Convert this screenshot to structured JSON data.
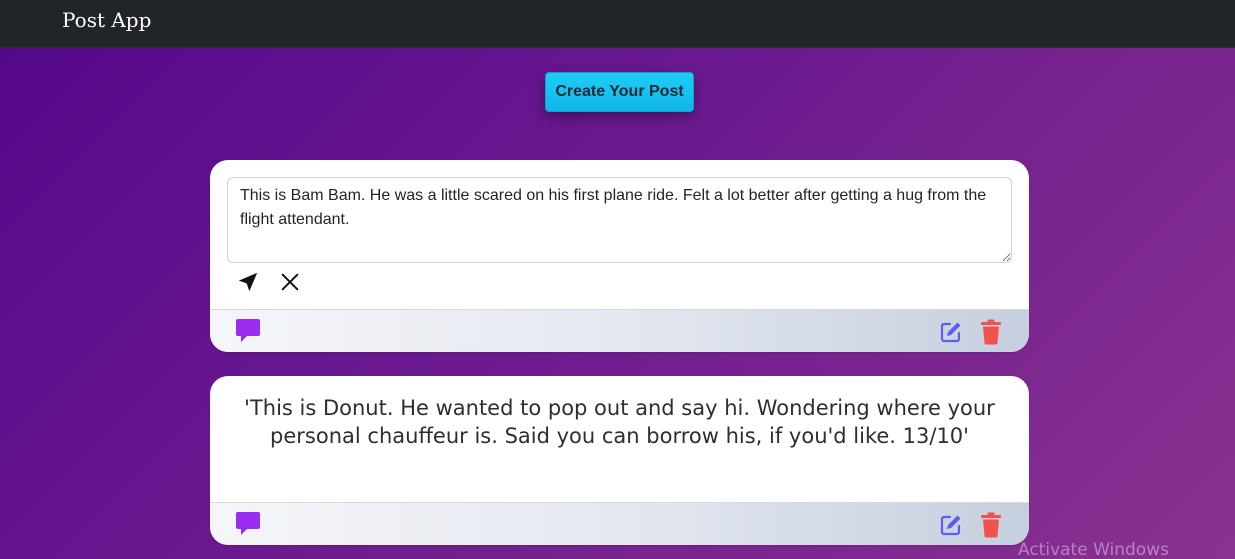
{
  "navbar": {
    "brand": "Post App"
  },
  "create_button": {
    "label": "Create Your Post"
  },
  "posts": [
    {
      "mode": "editing",
      "text": "This is Bam Bam. He was a little scared on his first plane ride. Felt a lot better after getting a hug from the flight attendant.",
      "actions": [
        "send-icon",
        "close-icon"
      ],
      "footer_icons": [
        "comment-icon",
        "edit-icon",
        "trash-icon"
      ]
    },
    {
      "mode": "view",
      "text": "'This is Donut. He wanted to pop out and say hi. Wondering where your personal chauffeur is. Said you can borrow his, if you'd like. 13/10'",
      "footer_icons": [
        "comment-icon",
        "edit-icon",
        "trash-icon"
      ]
    }
  ],
  "colors": {
    "comment": "#9b2bf0",
    "edit": "#5b5ff0",
    "delete": "#f0524c",
    "create_button": "#1fcdf6",
    "navbar": "#212529"
  },
  "watermark": "Activate Windows"
}
